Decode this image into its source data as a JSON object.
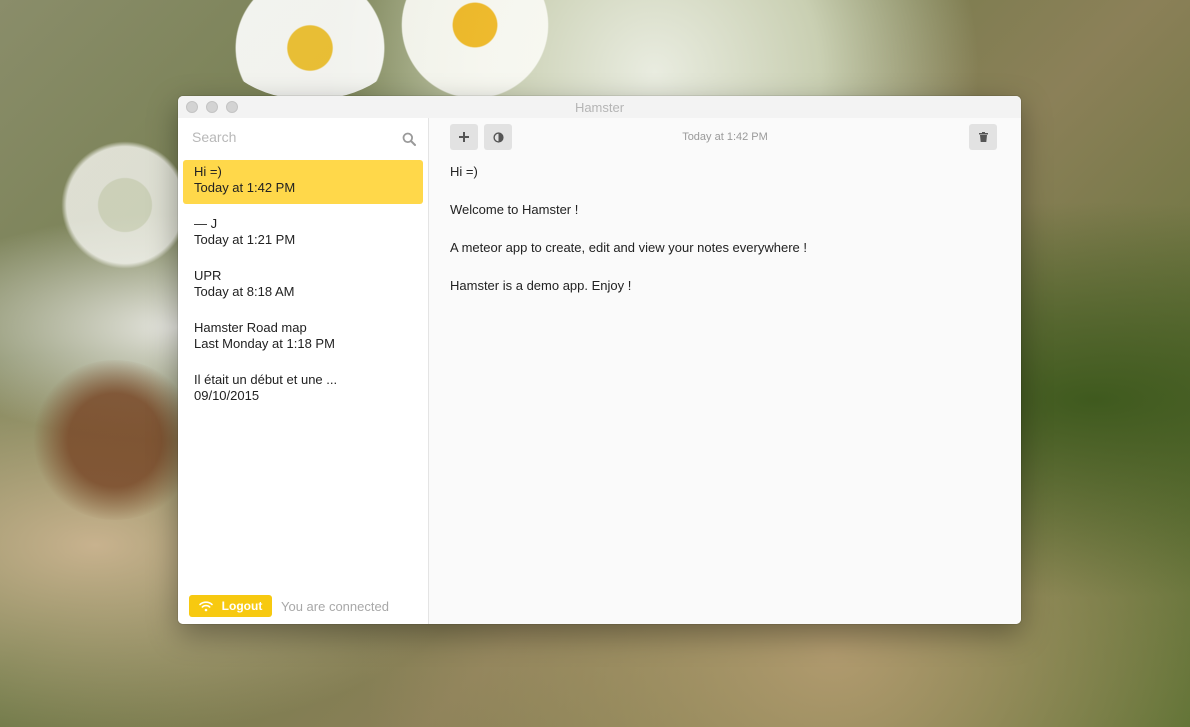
{
  "window": {
    "title": "Hamster"
  },
  "search": {
    "placeholder": "Search"
  },
  "notes": [
    {
      "title": "Hi =)",
      "date": "Today at 1:42 PM",
      "active": true
    },
    {
      "title": "— J",
      "date": "Today at 1:21 PM",
      "active": false
    },
    {
      "title": "UPR",
      "date": "Today at 8:18 AM",
      "active": false
    },
    {
      "title": "Hamster Road map",
      "date": "Last Monday at 1:18 PM",
      "active": false
    },
    {
      "title": "Il était un début et une ...",
      "date": "09/10/2015",
      "active": false
    }
  ],
  "footer": {
    "logout_label": "Logout",
    "status": "You are connected"
  },
  "editor": {
    "timestamp": "Today at 1:42 PM",
    "lines": [
      "Hi =)",
      "Welcome to Hamster !",
      "A meteor app to create, edit and view your notes everywhere !",
      "Hamster is a demo app.  Enjoy !"
    ]
  },
  "icons": {
    "new_note": "plus-icon",
    "theme": "contrast-icon",
    "delete": "trash-icon",
    "search": "search-icon",
    "wifi": "wifi-icon"
  },
  "colors": {
    "accent": "#ffd84a",
    "logout": "#f7c910"
  }
}
